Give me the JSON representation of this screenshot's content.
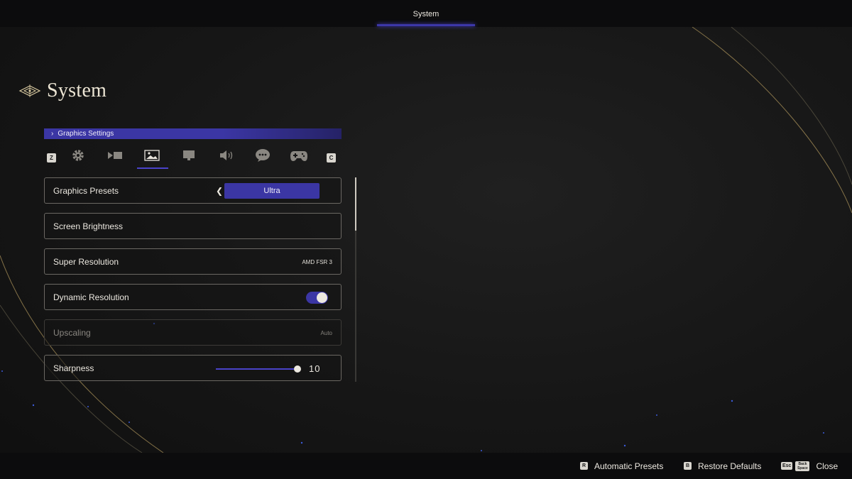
{
  "header": {
    "tab_label": "System"
  },
  "page": {
    "title": "System"
  },
  "section": {
    "label": "Graphics Settings"
  },
  "categories": {
    "prev_key": "Z",
    "next_key": "C",
    "items": [
      {
        "icon": "gear-icon"
      },
      {
        "icon": "camera-icon"
      },
      {
        "icon": "image-icon",
        "selected": true
      },
      {
        "icon": "monitor-icon"
      },
      {
        "icon": "speaker-icon"
      },
      {
        "icon": "speech-bubble-icon"
      },
      {
        "icon": "gamepad-icon"
      }
    ]
  },
  "settings": {
    "graphics_presets": {
      "label": "Graphics Presets",
      "value": "Ultra"
    },
    "screen_brightness": {
      "label": "Screen Brightness"
    },
    "super_resolution": {
      "label": "Super Resolution",
      "value": "AMD FSR 3"
    },
    "dynamic_resolution": {
      "label": "Dynamic Resolution",
      "enabled": true
    },
    "upscaling": {
      "label": "Upscaling",
      "value": "Auto",
      "disabled": true
    },
    "sharpness": {
      "label": "Sharpness",
      "value": "10",
      "fraction": 1.0
    }
  },
  "footer": {
    "automatic_presets": {
      "key": "R",
      "label": "Automatic Presets"
    },
    "restore_defaults": {
      "key": "B",
      "label": "Restore Defaults"
    },
    "close": {
      "key1": "Esc",
      "key2_line1": "Back",
      "key2_line2": "Space",
      "label": "Close"
    }
  },
  "colors": {
    "accent": "#3b36a4",
    "text": "#ece8e0",
    "background": "#161616"
  }
}
